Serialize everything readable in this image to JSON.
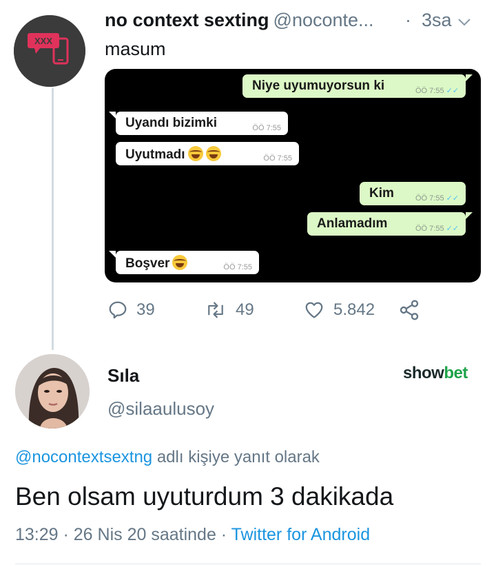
{
  "tweet": {
    "author_name": "no context sexting",
    "author_handle": "@noconte...",
    "dot": "·",
    "time": "3sa",
    "text": "masum",
    "avatar_label": "XXX",
    "chat": {
      "messages": [
        {
          "dir": "out",
          "text": "Niye uyumuyorsun ki",
          "time": "ÖÖ 7:55"
        },
        {
          "dir": "in",
          "text": "Uyandı bizimki",
          "time": "ÖÖ 7:55"
        },
        {
          "dir": "in",
          "text": "Uyutmadı",
          "time": "ÖÖ 7:55"
        },
        {
          "dir": "out",
          "text": "Kim",
          "time": "ÖÖ 7:55"
        },
        {
          "dir": "out",
          "text": "Anlamadım",
          "time": "ÖÖ 7:55"
        },
        {
          "dir": "in",
          "text": "Boşver",
          "time": "ÖÖ 7:55"
        }
      ],
      "read_ticks": "✓✓"
    },
    "actions": {
      "replies": "39",
      "retweets": "49",
      "likes": "5.842"
    }
  },
  "reply": {
    "author_name": "Sıla",
    "author_handle": "@silaaulusoy",
    "brand_part1": "show",
    "brand_part2": "bet",
    "reply_mention": "@nocontextsextng",
    "reply_suffix": " adlı kişiye yanıt olarak",
    "text": "Ben olsam uyuturdum 3 dakikada",
    "timestamp": "13:29 · 26 Nis 20 saatinde · ",
    "source": "Twitter for Android"
  },
  "colors": {
    "link": "#1b95e0",
    "muted": "#657786",
    "chat_out": "#dcf8c6",
    "brand_green": "#1fa34a"
  }
}
